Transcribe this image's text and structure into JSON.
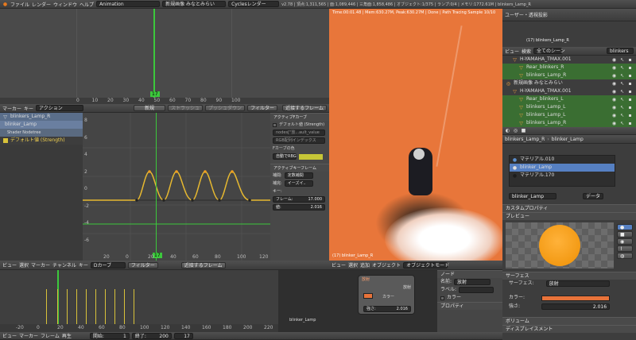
{
  "top_menu": {
    "file": "ファイル",
    "render": "レンダー",
    "window": "ウィンドウ",
    "help": "ヘルプ",
    "workspace": "Animation",
    "scene": "新規画像 みなとみらい",
    "engine": "Cyclesレンダー",
    "stats": "v2.78 | 頂点:1,311,565 | 面:1,089,446 | 三角面:1,858,486 | オブジェクト:1/375 | ランプ:0/4 | メモリ:1772.61M | blinkers_Lamp_R"
  },
  "timeline_top": {
    "ticks": [
      "0",
      "10",
      "20",
      "30",
      "40",
      "50",
      "60",
      "70",
      "80",
      "90",
      "100"
    ],
    "frame_badge": "17",
    "menu": [
      "マーカー",
      "キー"
    ],
    "action": "アクション",
    "new_btn": "新規",
    "stash": "ストラッシュ",
    "push": "プッシュダウン",
    "filter": "フィルター",
    "nearest": "近接するフレーム"
  },
  "channels": {
    "items": [
      "blinkers_Lamp_R",
      "blinker_Lamp",
      "Shader Nodetree",
      "デフォルト値 (Strength)"
    ]
  },
  "fcurve_graph": {
    "y_ticks": [
      "8",
      "6",
      "4",
      "2",
      "0",
      "-2",
      "-4",
      "-6"
    ],
    "x_ticks": [
      "20",
      "0",
      "20",
      "40",
      "60",
      "80",
      "100",
      "120"
    ],
    "frame_badge": "17"
  },
  "active_fcurve": {
    "title": "アクティブFカーブ",
    "name": "デフォルト値 (Strength)",
    "path": "nodes[\"放...ault_value",
    "rgb_index": "RGB配列インデックス",
    "display_color": "自動でRBG",
    "active_keyframe": "アクティブキーフレーム",
    "interp_label": "補間:",
    "interp": "定数補間",
    "easing_label": "補完:",
    "easing": "イーズイ..",
    "key_label": "キー:",
    "frame_label": "フレーム:",
    "frame_val": "17.000",
    "value_label": "値:",
    "value_val": "2.016",
    "modifiers": "Fカーブの色"
  },
  "viewport": {
    "render_info": "Time:00:01.48 | Mem:630.27M, Peak:630.27M | Done | Path Tracing Sample 10/10",
    "overlay": "(17) blinker_Lamp_R",
    "menu": [
      "ビュー",
      "選択",
      "追加",
      "オブジェクト"
    ],
    "mode": "オブジェクトモード",
    "colors": {
      "ground": "#e8763a",
      "light": "#f0f0f0"
    }
  },
  "dopesheet": {
    "menu": [
      "ビュー",
      "選択",
      "マーカー",
      "チャンネル",
      "キー"
    ],
    "mode": "Dカーブ",
    "filter": "フィルター",
    "nearest": "近接するフレーム",
    "ticks": [
      "-20",
      "0",
      "20",
      "40",
      "60",
      "80",
      "100",
      "120",
      "140",
      "160",
      "180",
      "200",
      "220"
    ]
  },
  "node_editor": {
    "node_title": "放射",
    "color_label": "カラー",
    "strength_label": "強さ:",
    "strength_val": "2.016",
    "out_label": "放射",
    "object_label": "blinker_Lamp"
  },
  "playback": {
    "menu": [
      "ビュー",
      "マーカー",
      "フレーム",
      "再生"
    ],
    "start_label": "開始:",
    "start": "1",
    "end_label": "終了:",
    "end": "200",
    "current": "17"
  },
  "outliner": {
    "header": "ユーザー・透視投影",
    "subtitle": "(17) blinkers_Lamp_R",
    "menu": [
      "ビュー",
      "検索",
      "全てのシーン"
    ],
    "search": "blinkers",
    "rows": [
      {
        "label": "H-YAMAHA_TMAX.001",
        "level": 1,
        "sel": false
      },
      {
        "label": "Rear_blinkers_R",
        "level": 2,
        "sel": true
      },
      {
        "label": "blinkers_Lamp_R",
        "level": 2,
        "sel": true
      },
      {
        "label": "新規画像 みなとみらい",
        "level": 0,
        "sel": false
      },
      {
        "label": "H-YAMAHA_TMAX.001",
        "level": 1,
        "sel": false
      },
      {
        "label": "Rear_blinkers_L",
        "level": 2,
        "sel": true
      },
      {
        "label": "blinkers_Lamp_L",
        "level": 2,
        "sel": true
      },
      {
        "label": "blinkers_Lamp_L",
        "level": 2,
        "sel": true
      },
      {
        "label": "blinkers_Lamp_R",
        "level": 2,
        "sel": true
      }
    ]
  },
  "properties": {
    "breadcrumb_a": "blinkers_Lamp_R",
    "breadcrumb_b": "blinker_Lamp",
    "materials": [
      "マテリアル.010",
      "blinker_Lamp",
      "マテリアル.170"
    ],
    "mat_field": "blinker_Lamp",
    "data_label": "データ",
    "custom_props": "カスタムプロパティ",
    "preview": "プレビュー",
    "surface": "サーフェス",
    "surface_label": "サーフェス:",
    "surface_val": "放射",
    "color_label": "カラー:",
    "strength_label": "強さ:",
    "strength_val": "2.016",
    "volume": "ボリューム",
    "displacement": "ディスプレイスメント"
  },
  "node_side": {
    "node": "ノード",
    "name_label": "名前:",
    "name_val": "放射",
    "label_label": "ラベル:",
    "color": "カラー",
    "props": "プロパティ"
  },
  "accent": "#e87a1e"
}
